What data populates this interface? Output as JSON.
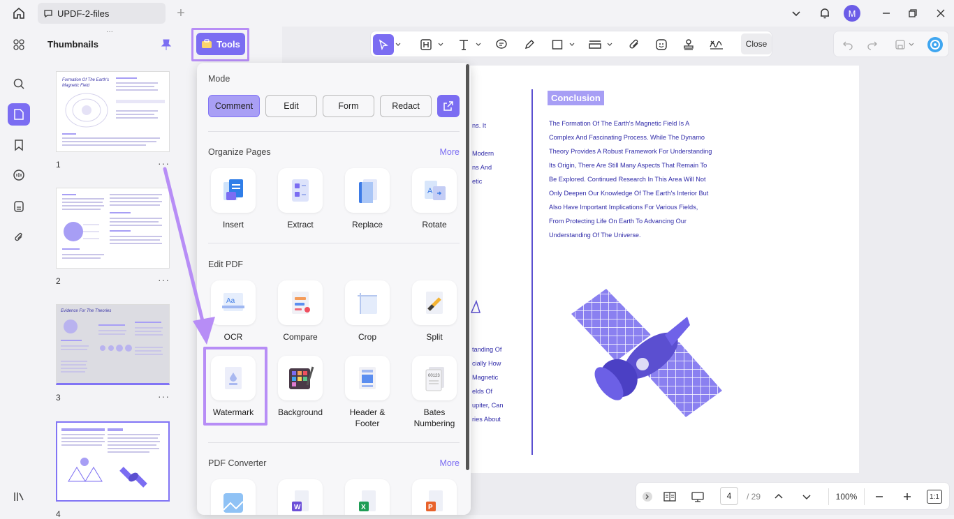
{
  "titlebar": {
    "tab_label": "UPDF-2-files",
    "avatar_initial": "M"
  },
  "thumbnails": {
    "title": "Thumbnails",
    "pages": [
      "1",
      "2",
      "3",
      "4"
    ],
    "more": "···",
    "thumb1_title": "Formation Of The Earth's Magnetic Field",
    "thumb3_title": "Evidence For The Theories"
  },
  "tools_button": {
    "label": "Tools"
  },
  "toolbar": {
    "close_label": "Close"
  },
  "panel": {
    "mode_title": "Mode",
    "modes": [
      "Comment",
      "Edit",
      "Form",
      "Redact"
    ],
    "organize_title": "Organize Pages",
    "more_label": "More",
    "organize": [
      "Insert",
      "Extract",
      "Replace",
      "Rotate"
    ],
    "edit_title": "Edit PDF",
    "edit_row1": [
      "OCR",
      "Compare",
      "Crop",
      "Split"
    ],
    "edit_row2": [
      "Watermark",
      "Background",
      "Header &\nFooter",
      "Bates\nNumbering"
    ],
    "converter_title": "PDF Converter"
  },
  "document": {
    "heading": "Conclusion",
    "lines": [
      "The Formation Of The Earth's Magnetic Field Is A",
      "Complex And Fascinating Process. While The Dynamo",
      "Theory Provides A Robust Framework For Understanding",
      "Its Origin, There Are Still Many Aspects That Remain To",
      "Be Explored. Continued Research In This Area Will Not",
      "Only Deepen Our Knowledge Of The Earth's Interior But",
      "Also Have Important Implications For Various Fields,",
      "From Protecting Life On Earth To Advancing Our",
      "Understanding Of The Universe."
    ],
    "left_fragments_top": [
      "ns. It",
      "Modern",
      "ns And",
      "etic"
    ],
    "left_fragments_bottom": [
      "tanding Of",
      "cially How",
      "Magnetic",
      "elds Of",
      "upiter, Can",
      "ries About"
    ]
  },
  "bottombar": {
    "page_current": "4",
    "page_total": "/ 29",
    "zoom": "100%",
    "fit_label": "1:1"
  },
  "colors": {
    "accent": "#7b6df2",
    "highlight": "#b78df6",
    "doc_text": "#2f2aa8"
  }
}
